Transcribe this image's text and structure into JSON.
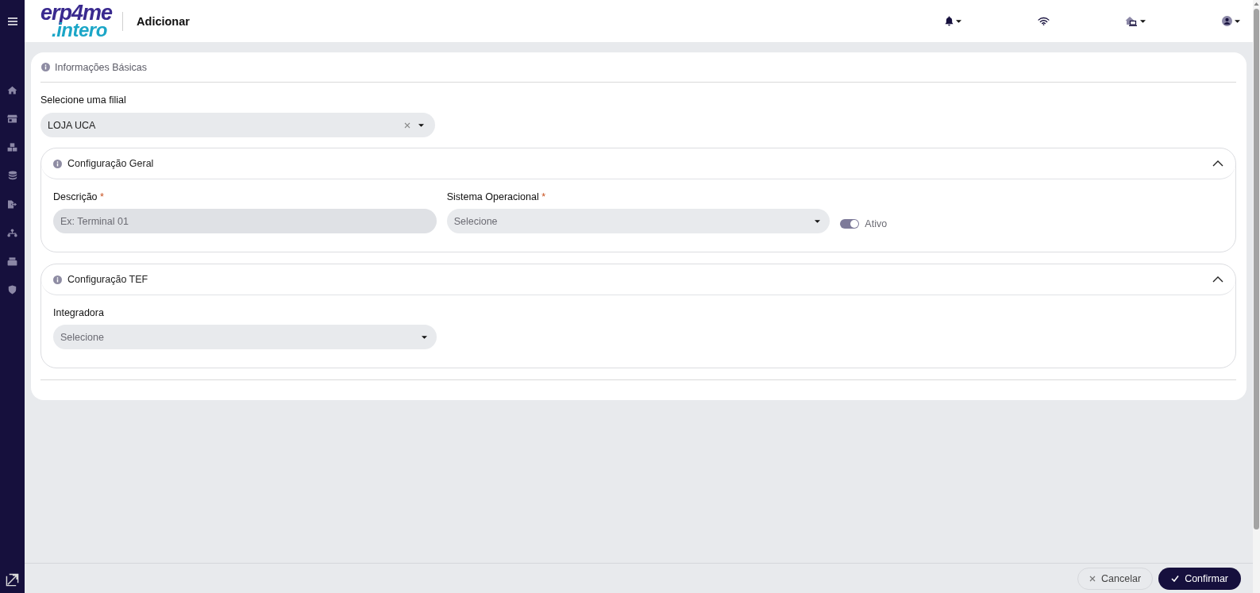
{
  "header": {
    "logo": {
      "top": "erp4me",
      "bottom": ".intero"
    },
    "title": "Adicionar"
  },
  "card": {
    "title": "Informações Básicas",
    "branch_select": {
      "label": "Selecione uma filial",
      "value": "LOJA UCA"
    },
    "sections": [
      {
        "title": "Configuração Geral",
        "expanded": true,
        "fields": [
          {
            "kind": "text",
            "label": "Descrição",
            "required_mark": "*",
            "placeholder": "Ex: Terminal 01"
          },
          {
            "kind": "select",
            "label": "Sistema Operacional",
            "required_mark": "*",
            "placeholder": "Selecione"
          },
          {
            "kind": "toggle",
            "label": "Ativo",
            "on": true
          }
        ]
      },
      {
        "title": "Configuração TEF",
        "expanded": true,
        "fields": [
          {
            "kind": "select",
            "label": "Integradora",
            "placeholder": "Selecione"
          }
        ]
      }
    ]
  },
  "footer": {
    "buttons": [
      {
        "kind": "cancel",
        "label": "Cancelar"
      },
      {
        "kind": "confirm",
        "label": "Confirmar"
      }
    ]
  }
}
